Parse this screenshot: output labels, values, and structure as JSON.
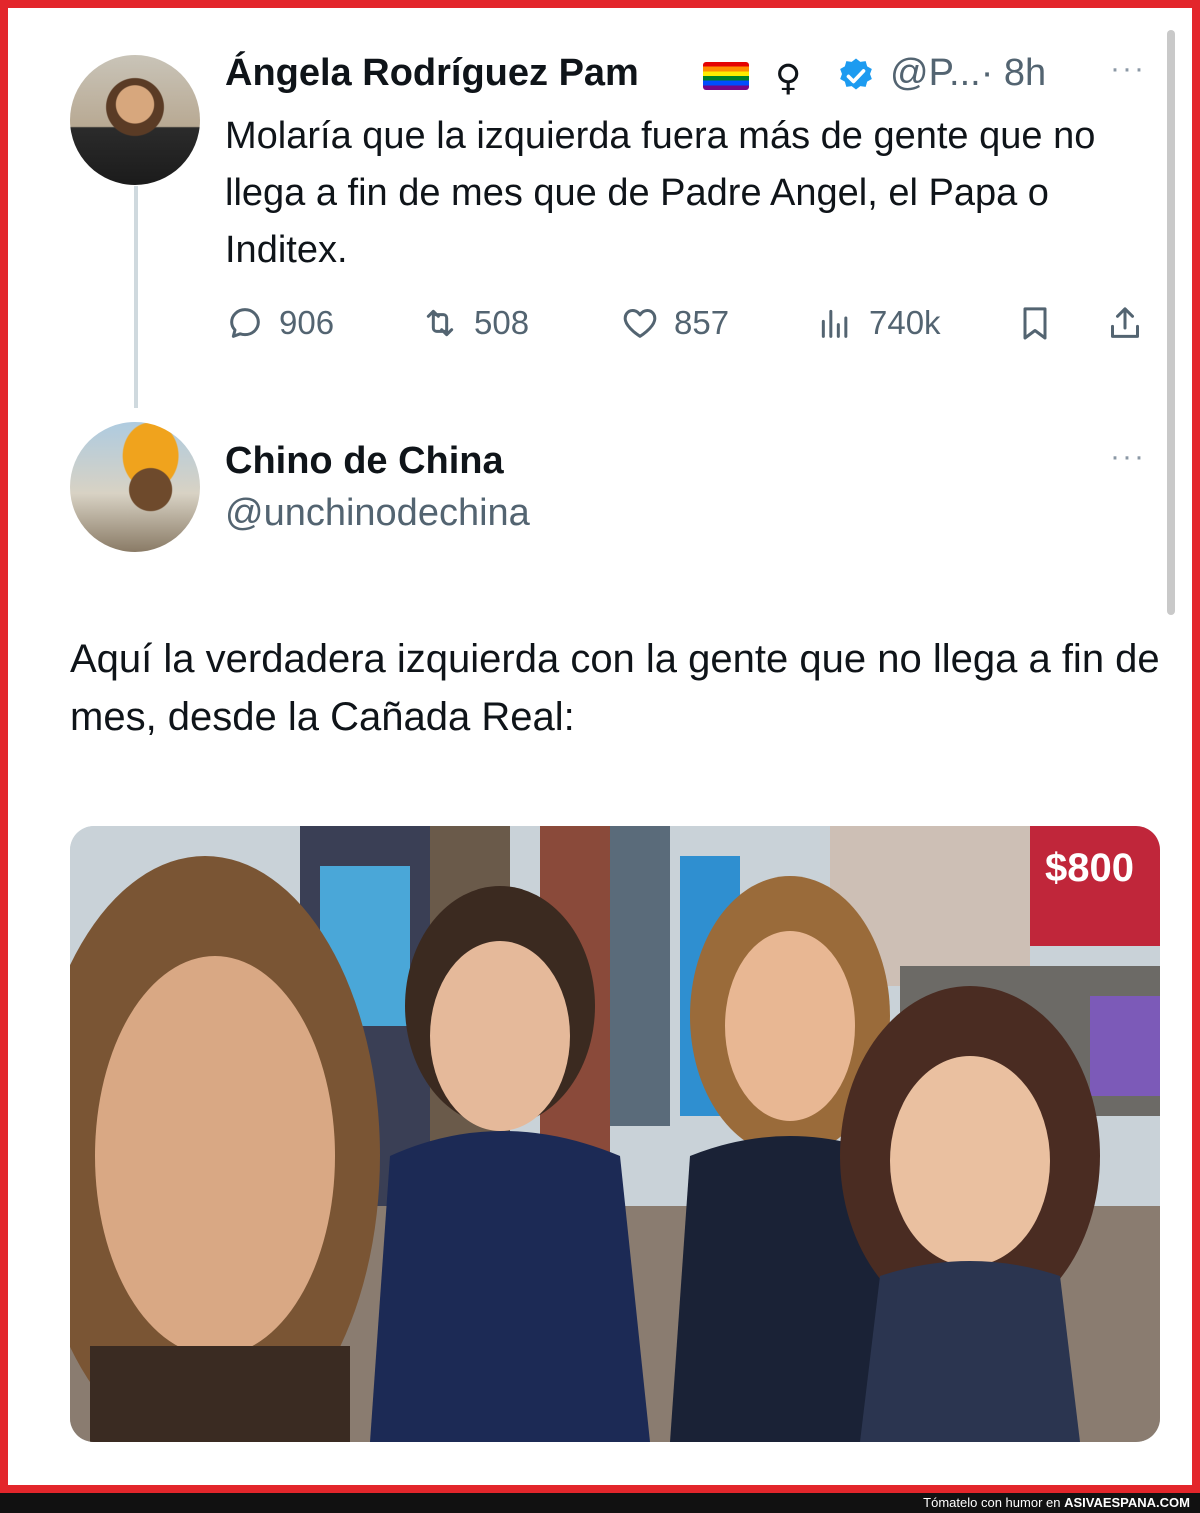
{
  "tweet1": {
    "author_name": "Ángela Rodríguez Pam",
    "female_symbol": "♀",
    "handle": "@P...",
    "time": "· 8h",
    "more": "···",
    "text": "Molaría que la izquierda fuera más de gente que no llega a fin de mes que de Padre Angel, el Papa o Inditex.",
    "stats": {
      "replies": "906",
      "retweets": "508",
      "likes": "857",
      "views": "740k"
    },
    "icons": [
      "rainbow-flag-icon",
      "verified-badge-icon",
      "reply-icon",
      "retweet-icon",
      "like-icon",
      "views-icon",
      "bookmark-icon",
      "share-icon"
    ],
    "verified_color": "#1d9bf0"
  },
  "tweet2": {
    "author_name": "Chino de China",
    "handle": "@unchinodechina",
    "more": "···",
    "text": "Aquí la verdadera izquierda con la gente que no llega a fin de mes, desde la Cañada Real:",
    "photo": {
      "billboard_text": "$800"
    }
  },
  "footer": {
    "prefix": "Tómatelo con humor en ",
    "site": "ASIVAESPANA.COM"
  },
  "colors": {
    "frame": "#e3262b",
    "muted": "#536471"
  }
}
